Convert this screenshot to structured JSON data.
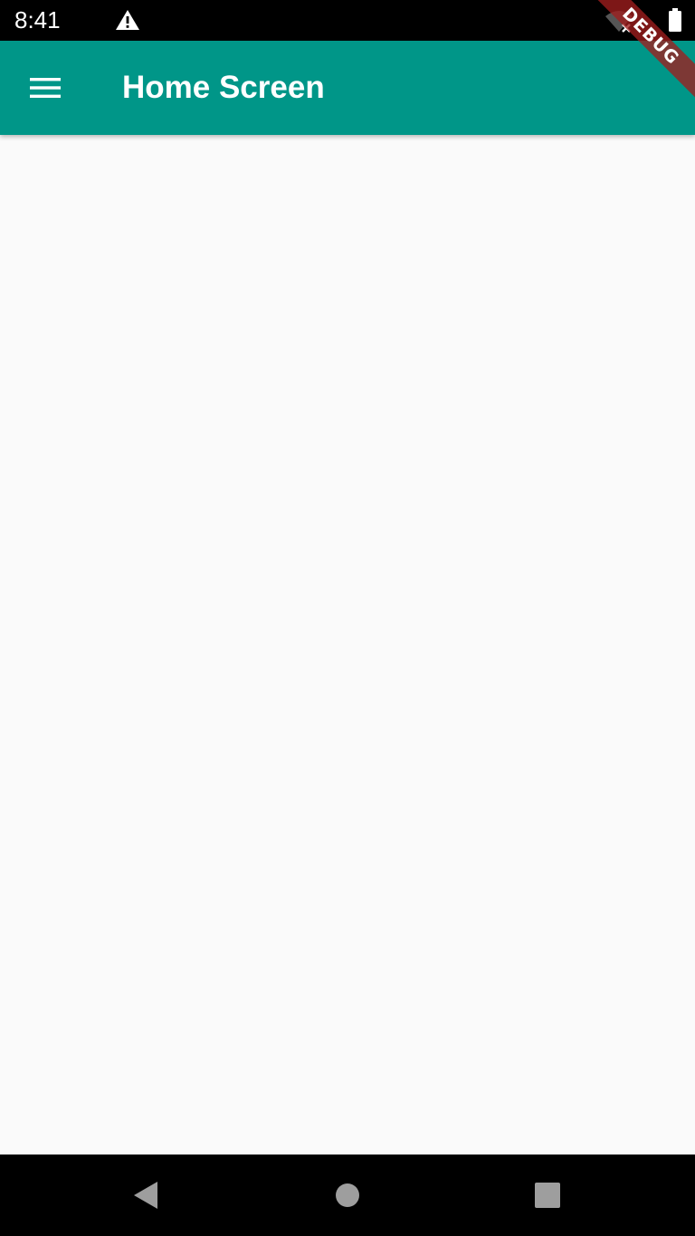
{
  "status_bar": {
    "time": "8:41",
    "icons": [
      "warning-icon",
      "wifi-off-icon",
      "battery-icon"
    ]
  },
  "app_bar": {
    "title": "Home Screen",
    "menu_icon": "hamburger-menu-icon",
    "color": "#009688"
  },
  "debug_banner": {
    "label": "DEBUG"
  },
  "nav_bar": {
    "icons": [
      "back-icon",
      "home-icon",
      "recents-icon"
    ]
  },
  "colors": {
    "app_bar": "#009688",
    "background": "#fafafa",
    "system_bars": "#000000",
    "debug_ribbon": "#a01e1e"
  }
}
